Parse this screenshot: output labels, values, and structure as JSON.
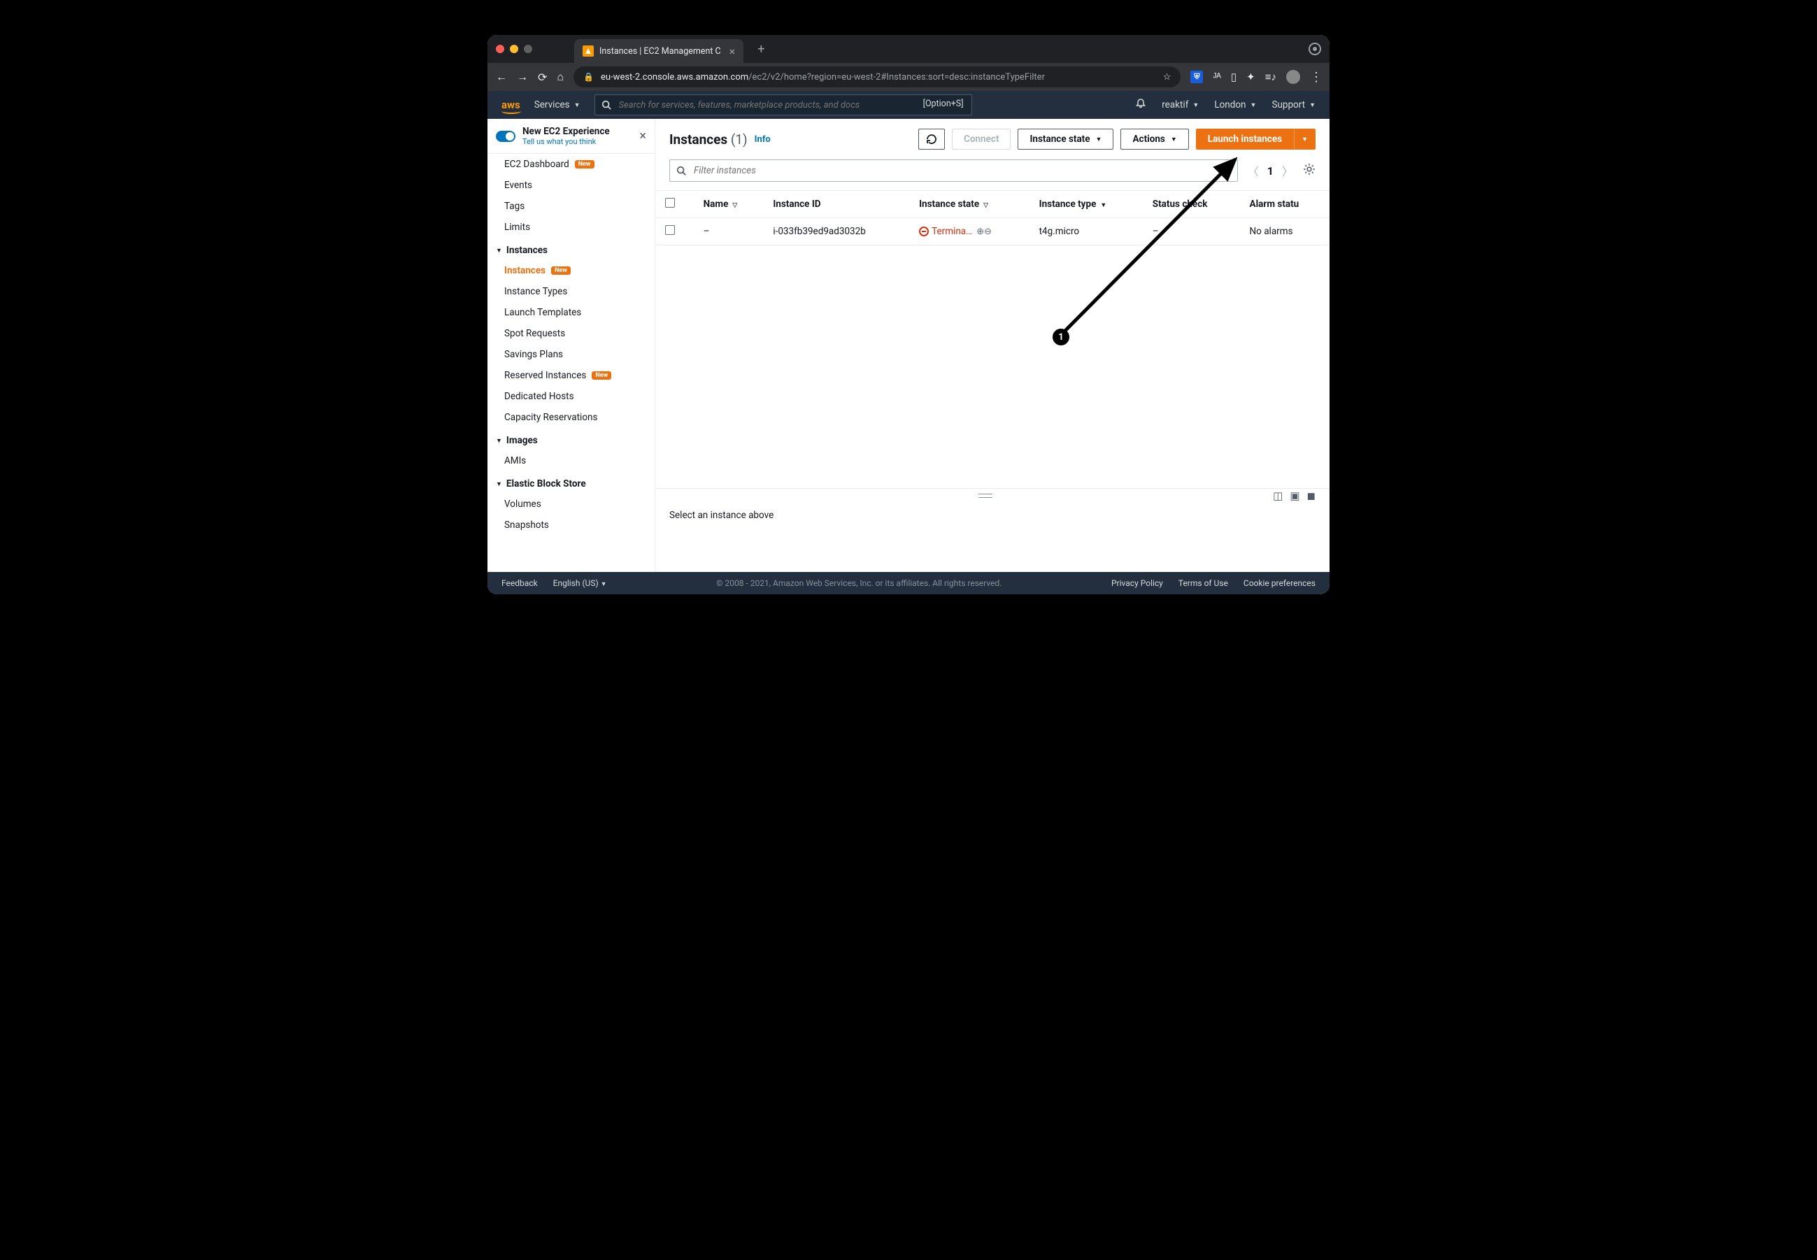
{
  "browser": {
    "tab_title": "Instances | EC2 Management C",
    "url_host": "eu-west-2.console.aws.amazon.com",
    "url_path": "/ec2/v2/home?region=eu-west-2#Instances:sort=desc:instanceTypeFilter"
  },
  "aws_top": {
    "logo": "aws",
    "services": "Services",
    "search_placeholder": "Search for services, features, marketplace products, and docs",
    "search_kbd": "[Option+S]",
    "account": "reaktif",
    "region": "London",
    "support": "Support"
  },
  "experience_banner": {
    "title": "New EC2 Experience",
    "sub": "Tell us what you think"
  },
  "sidebar": {
    "dashboard": "EC2 Dashboard",
    "dashboard_badge": "New",
    "events": "Events",
    "tags": "Tags",
    "limits": "Limits",
    "sec_instances": "Instances",
    "instances": "Instances",
    "instances_badge": "New",
    "instance_types": "Instance Types",
    "launch_templates": "Launch Templates",
    "spot_requests": "Spot Requests",
    "savings_plans": "Savings Plans",
    "reserved_instances": "Reserved Instances",
    "reserved_badge": "New",
    "dedicated_hosts": "Dedicated Hosts",
    "capacity_reservations": "Capacity Reservations",
    "sec_images": "Images",
    "amis": "AMIs",
    "sec_ebs": "Elastic Block Store",
    "volumes": "Volumes",
    "snapshots": "Snapshots"
  },
  "header": {
    "title": "Instances",
    "count": "(1)",
    "info": "Info",
    "connect": "Connect",
    "instance_state": "Instance state",
    "actions": "Actions",
    "launch": "Launch instances"
  },
  "filter": {
    "placeholder": "Filter instances",
    "page": "1"
  },
  "table": {
    "col_name": "Name",
    "col_instance_id": "Instance ID",
    "col_instance_state": "Instance state",
    "col_instance_type": "Instance type",
    "col_status_check": "Status check",
    "col_alarm_status": "Alarm statu",
    "row": {
      "name": "–",
      "instance_id": "i-033fb39ed9ad3032b",
      "instance_state": "Termina…",
      "instance_type": "t4g.micro",
      "status_check": "–",
      "alarm_status": "No alarms"
    }
  },
  "detail": {
    "message": "Select an instance above"
  },
  "footer": {
    "feedback": "Feedback",
    "language": "English (US)",
    "copyright": "© 2008 - 2021, Amazon Web Services, Inc. or its affiliates. All rights reserved.",
    "privacy": "Privacy Policy",
    "terms": "Terms of Use",
    "cookies": "Cookie preferences"
  },
  "annotation": {
    "badge": "1"
  }
}
